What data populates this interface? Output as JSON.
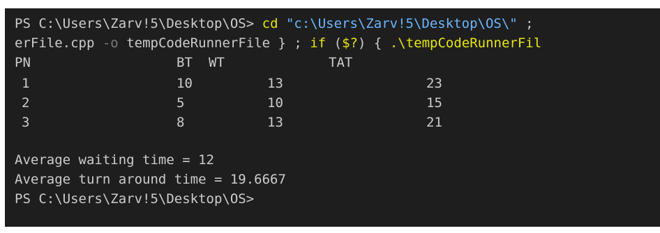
{
  "terminal": {
    "line1": {
      "prompt": "PS C:\\Users\\Zarv!5\\Desktop\\OS>",
      "cmd": "cd",
      "path": "\"c:\\Users\\Zarv!5\\Desktop\\OS\\\"",
      "rest": ";"
    },
    "line2": {
      "part1": "erFile.cpp",
      "flag": "-o",
      "part2": "tempCodeRunnerFile } ;",
      "if_kw": "if",
      "cond": "($?)",
      "brace": "{",
      "exe": ".\\tempCodeRunnerFil"
    },
    "headers": {
      "pn": "PN",
      "bt": "BT",
      "wt": "WT",
      "tat": "TAT"
    },
    "rows": [
      {
        "pn": "1",
        "bt": "10",
        "wt": "13",
        "tat": "23"
      },
      {
        "pn": "2",
        "bt": "5",
        "wt": "10",
        "tat": "15"
      },
      {
        "pn": "3",
        "bt": "8",
        "wt": "13",
        "tat": "21"
      }
    ],
    "avg_waiting": "Average waiting time = 12",
    "avg_turnaround": "Average turn around time = 19.6667",
    "final_prompt": "PS C:\\Users\\Zarv!5\\Desktop\\OS>"
  },
  "colors": {
    "background": "#1e1e1e",
    "text": "#cccccc",
    "command": "#e5e510",
    "string": "#6cb6ff",
    "flag": "#7a7a7a"
  }
}
